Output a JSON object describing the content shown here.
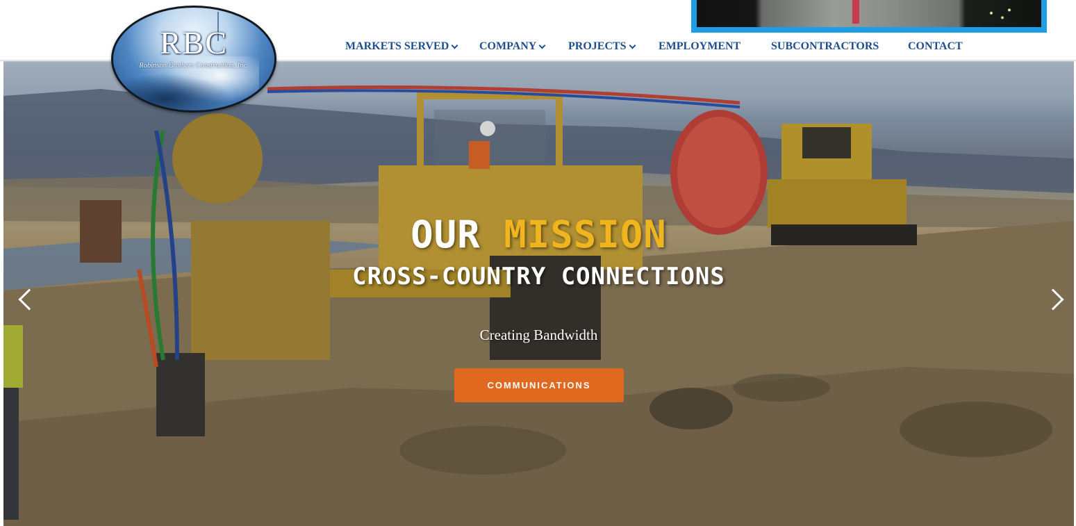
{
  "brand": {
    "logo_letters": "RBC",
    "logo_subtitle": "Robinson Brothers Construction, Inc."
  },
  "nav": {
    "items": [
      {
        "label": "MARKETS SERVED",
        "dropdown": true
      },
      {
        "label": "COMPANY",
        "dropdown": true
      },
      {
        "label": "PROJECTS",
        "dropdown": true
      },
      {
        "label": "EMPLOYMENT",
        "dropdown": false
      },
      {
        "label": "SUBCONTRACTORS",
        "dropdown": false
      },
      {
        "label": "CONTACT",
        "dropdown": false
      }
    ]
  },
  "slide": {
    "title_word_1": "OUR",
    "title_word_2": "MISSION",
    "subtitle": "CROSS-COUNTRY CONNECTIONS",
    "tagline": "Creating Bandwidth",
    "cta_label": "COMMUNICATIONS"
  },
  "icons": {
    "prev": "chevron-left-icon",
    "next": "chevron-right-icon",
    "dropdown": "chevron-down-icon"
  },
  "colors": {
    "nav_text": "#1e4f8e",
    "accent_yellow": "#f0b41e",
    "cta_orange": "#e0691f",
    "video_border": "#1f9ee5"
  }
}
